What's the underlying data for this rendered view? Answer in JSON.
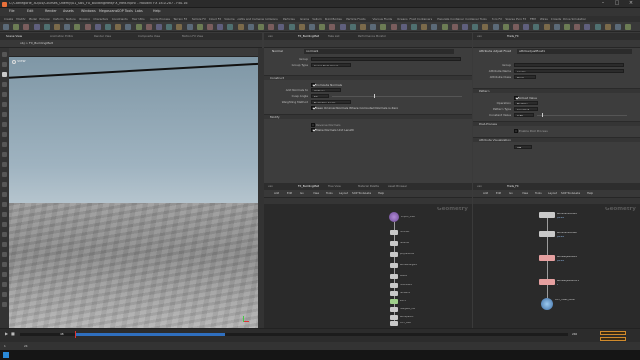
{
  "window": {
    "title": "C:/Cathegorie_3D/04/Courses_Udemy/01_SBS_FX_BuildingMelt/FX_Melt.hipnc - Houdini FX 18.0.287 - Fx0.16",
    "minimize_icon": "minimize-icon",
    "maximize_icon": "maximize-icon",
    "close_icon": "close-icon"
  },
  "menu": [
    "File",
    "Edit",
    "Render",
    "Assets",
    "Windows",
    "Megascans",
    "SOP Tools",
    "Labs",
    "Help"
  ],
  "shelf_tabs": [
    "Create",
    "Modify",
    "Model",
    "Polygon",
    "Deform",
    "Texture",
    "Rigging",
    "Characters",
    "Constraints",
    "Hair Utils",
    "Guide Process",
    "Terrain FX",
    "Simple FX",
    "Cloud FX",
    "Volume",
    "Lights and Cameras",
    "Collisions",
    "Particles",
    "Grains",
    "Vellum",
    "Rigid Bodies",
    "Particle Fluids",
    "Viscous Fluids",
    "Oceans",
    "Fluid Containers",
    "Populate Containers",
    "Container Tools",
    "Pyro FX",
    "Sparse Pyro FX",
    "FEM",
    "Wires",
    "Crowds",
    "Drive Simulation"
  ],
  "viewport": {
    "path": "obj > FX_BuildingMelt",
    "label": "View",
    "tabs": [
      "Scene View",
      "Animation Editor",
      "Render View",
      "Composite View",
      "Motion FX View"
    ]
  },
  "param_left": {
    "tabs": [
      "vex",
      "FX_BuildingMelt",
      "Take List",
      "Performance Monitor"
    ],
    "node_type": "Normal",
    "node_name": "normal1",
    "group_label": "Group",
    "group_type_label": "Group Type",
    "group_type_value": "Guess from Group",
    "section": "Construct",
    "compute_normals_label": "Compute Normals",
    "add_normals_to_label": "Add Normals to",
    "add_normals_to_value": "Vertices",
    "cusp_angle_label": "Cusp Angle",
    "cusp_angle_value": "60",
    "weighting_label": "Weighting Method",
    "weighting_value": "By Vertex Angle",
    "keep_label": "Keep Original Normals Where Computed Normals is Zero",
    "section2": "Modify",
    "reverse_label": "Reverse Normals",
    "make_normals_label": "Make Normals Unit Length"
  },
  "param_right": {
    "tabs": [
      "vex",
      "Trails_FX"
    ],
    "node_type": "Attribute Adjust Float",
    "node_name": "attribadjustfloat1",
    "group_label": "Group",
    "attribute_label": "Attribute Name",
    "attribute_value": "pscale",
    "class_label": "Attribute Class",
    "class_value": "Point",
    "section": "Pattern",
    "adjust_label": "Adjust Value",
    "adjust_value_label": "Operation",
    "adjust_value_value": "Multiply",
    "pattern_type_label": "Pattern Type",
    "pattern_type_value": "Constant",
    "constant_label": "Constant Value",
    "constant_value": "0.55",
    "post_process_label": "Post-Process",
    "enable_label": "Enable Post Process",
    "visualize_label": "Attribute Visualization",
    "visualize_value": "Off"
  },
  "network_left": {
    "tabs": [
      "vex",
      "FX_BuildingMelt",
      "Tree View",
      "Material Palette",
      "Asset Browser"
    ],
    "menu": [
      "Add",
      "Edit",
      "Go",
      "View",
      "Tools",
      "Layout",
      "SOP Tools",
      "Labs",
      "Help"
    ],
    "context": "Geometry",
    "nodes": [
      "import_melt",
      "normal1",
      "reduce1",
      "polyreduce1",
      "attribwrangle1",
      "blast1",
      "mountain1",
      "remesh1",
      "sort1",
      "mergeAll_out",
      "attribpaint1",
      "OUT_Melt"
    ]
  },
  "network_right": {
    "tabs": [
      "vex",
      "Trails_FX"
    ],
    "menu": [
      "Add",
      "Edit",
      "Go",
      "View",
      "Tools",
      "Layout",
      "SOP Tools",
      "Labs",
      "Help"
    ],
    "context": "Geometry",
    "nodes": [
      {
        "name": "attribrandomize1",
        "sub": "pscale"
      },
      {
        "name": "attribrandomize2",
        "sub": "pscale"
      },
      {
        "name": "attribadjustfloat1",
        "sub": "pscale"
      },
      {
        "name": "attribadjustvector1",
        "sub": "v"
      },
      {
        "name": "OUT_TRAIL_MESH",
        "sub": ""
      }
    ]
  },
  "timeline": {
    "start": "1",
    "end": "240",
    "current": "48",
    "fps": "24"
  },
  "colors": {
    "accent": "#2f6fbf",
    "pane_bg": "#3d3d3d",
    "network_bg": "#2a2a2a"
  }
}
